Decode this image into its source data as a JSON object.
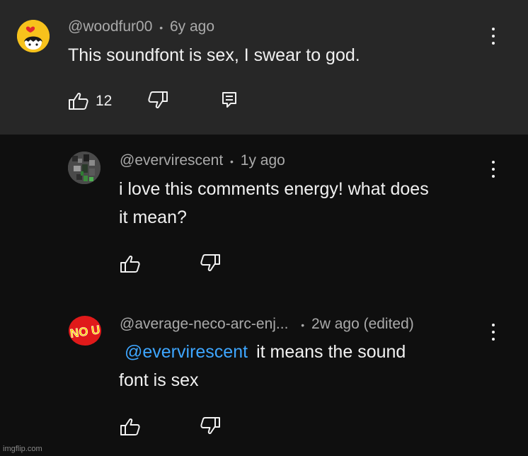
{
  "comments": [
    {
      "author": "@woodfur00",
      "separator": "•",
      "time": "6y ago",
      "text": "This soundfont is sex, I swear to god.",
      "likes": "12"
    },
    {
      "author": "@evervirescent",
      "separator": "•",
      "time": "1y ago",
      "text_line1": "i love this comments energy! what does",
      "text_line2": "it mean?"
    },
    {
      "author": "@average-neco-arc-enj...",
      "separator": "•",
      "time": "2w ago (edited)",
      "mention": "@evervirescent",
      "text_line1": "it means the sound",
      "text_line2": "font is sex",
      "avatar_text": "NO U"
    }
  ],
  "watermark": "imgflip.com",
  "colors": {
    "background": "#0f0f0f",
    "highlight_background": "#272727",
    "mention": "#3ea6ff",
    "meta_text": "#aaaaaa"
  },
  "icons": [
    "like-icon",
    "dislike-icon",
    "reply-icon",
    "more-options-icon"
  ]
}
